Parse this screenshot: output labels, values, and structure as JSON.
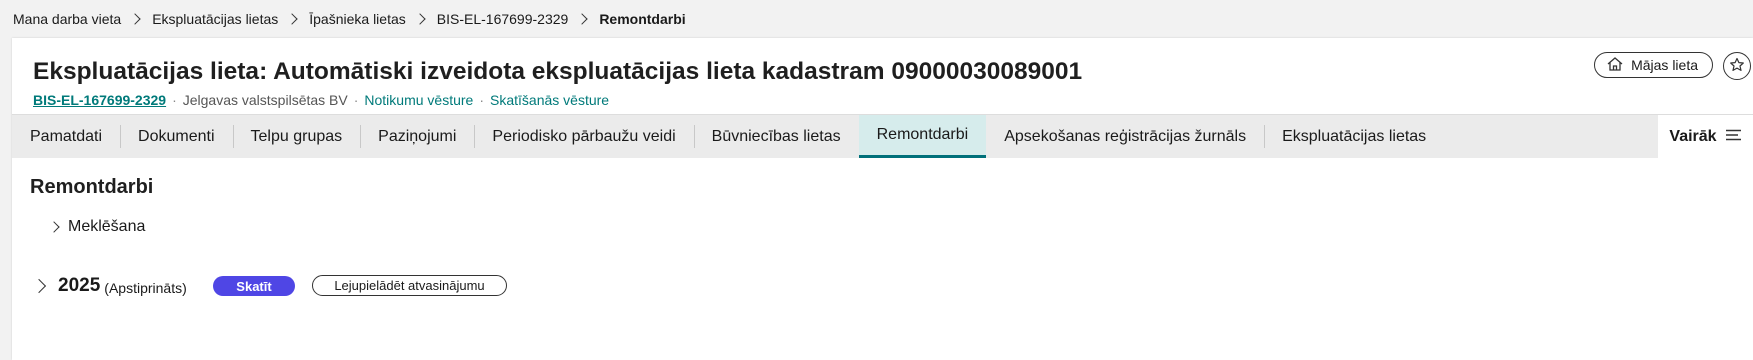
{
  "breadcrumb": [
    "Mana darba vieta",
    "Ekspluatācijas lietas",
    "Īpašnieka lietas",
    "BIS-EL-167699-2329",
    "Remontdarbi"
  ],
  "header": {
    "title": "Ekspluatācijas lieta: Automātiski izveidota ekspluatācijas lieta kadastram 09000030089001",
    "case_id": "BIS-EL-167699-2329",
    "owner": "Jelgavas valstspilsētas BV",
    "event_history": "Notikumu vēsture",
    "view_history": "Skatīšanās vēsture",
    "house_button": "Mājas lieta"
  },
  "tabs": [
    "Pamatdati",
    "Dokumenti",
    "Telpu grupas",
    "Paziņojumi",
    "Periodisko pārbaužu veidi",
    "Būvniecības lietas",
    "Remontdarbi",
    "Apsekošanas reģistrācijas žurnāls",
    "Ekspluatācijas lietas"
  ],
  "active_tab_index": 6,
  "more_label": "Vairāk",
  "main": {
    "section_title": "Remontdarbi",
    "search_label": "Meklēšana",
    "year": "2025",
    "year_status": "(Apstiprināts)",
    "view_button": "Skatīt",
    "download_button": "Lejupielādēt atvasinājumu"
  },
  "colors": {
    "accent": "#007a7a",
    "active_tab_bg": "#d6ecec",
    "primary_button": "#4f46e5"
  }
}
